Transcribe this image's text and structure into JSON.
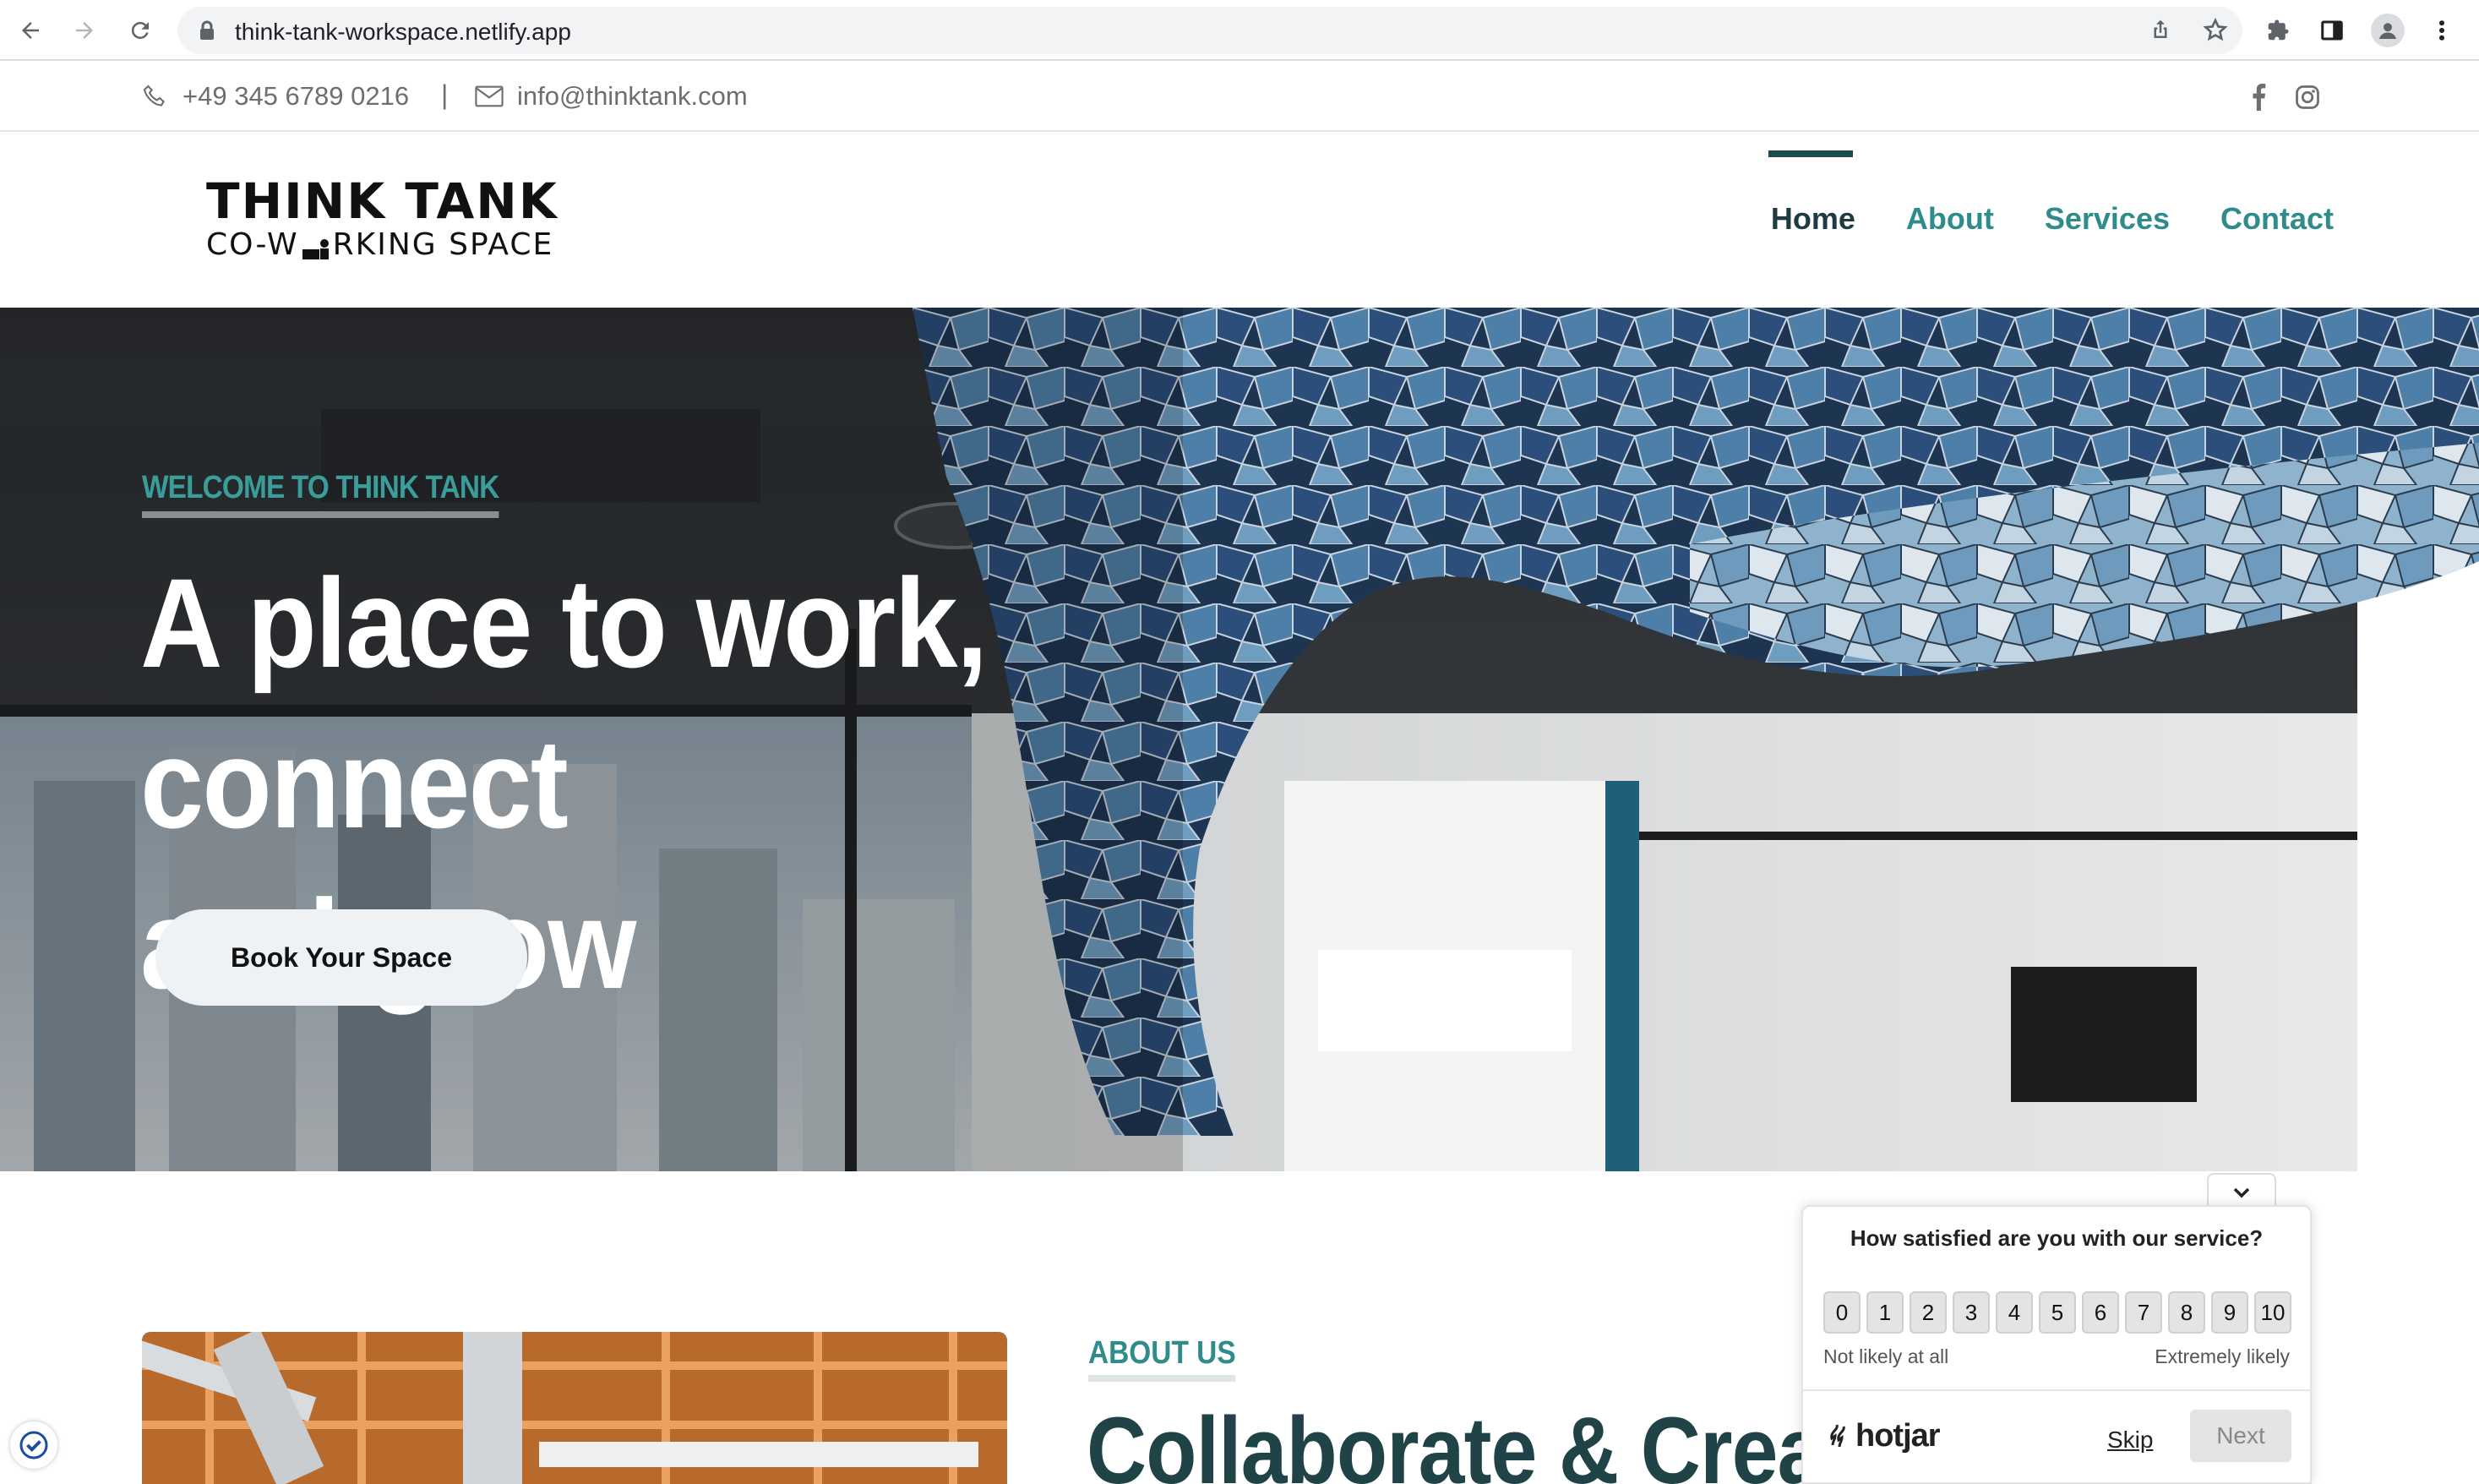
{
  "browser": {
    "url": "think-tank-workspace.netlify.app",
    "icons": [
      "back-icon",
      "forward-icon",
      "reload-icon",
      "lock-icon",
      "share-icon",
      "bookmark-star-icon",
      "extensions-icon",
      "side-panel-icon",
      "profile-icon",
      "menu-kebab-icon"
    ]
  },
  "topbar": {
    "phone": "+49 345 6789 0216",
    "separator": "|",
    "email": "info@thinktank.com",
    "social": [
      "facebook-icon",
      "instagram-icon"
    ]
  },
  "header": {
    "logo_line1": "THINK TANK",
    "logo_line2_left": "CO-W",
    "logo_line2_right": "RKING SPACE",
    "nav": [
      {
        "label": "Home",
        "active": true
      },
      {
        "label": "About",
        "active": false
      },
      {
        "label": "Services",
        "active": false
      },
      {
        "label": "Contact",
        "active": false
      }
    ]
  },
  "hero": {
    "eyebrow": "WELCOME TO THINK TANK",
    "headline_line1": "A place to work, connect",
    "headline_line2": "and grow",
    "cta": "Book Your Space"
  },
  "about": {
    "label": "ABOUT US",
    "title": "Collaborate & Creat"
  },
  "hotjar": {
    "question": "How satisfied are you with our service?",
    "scale": [
      "0",
      "1",
      "2",
      "3",
      "4",
      "5",
      "6",
      "7",
      "8",
      "9",
      "10"
    ],
    "low_label": "Not likely at all",
    "high_label": "Extremely likely",
    "brand": "hotjar",
    "skip": "Skip",
    "next": "Next"
  },
  "colors": {
    "accent_teal": "#2f8c8a",
    "dark_teal": "#1f4347",
    "nav_active": "#1d3b40"
  }
}
